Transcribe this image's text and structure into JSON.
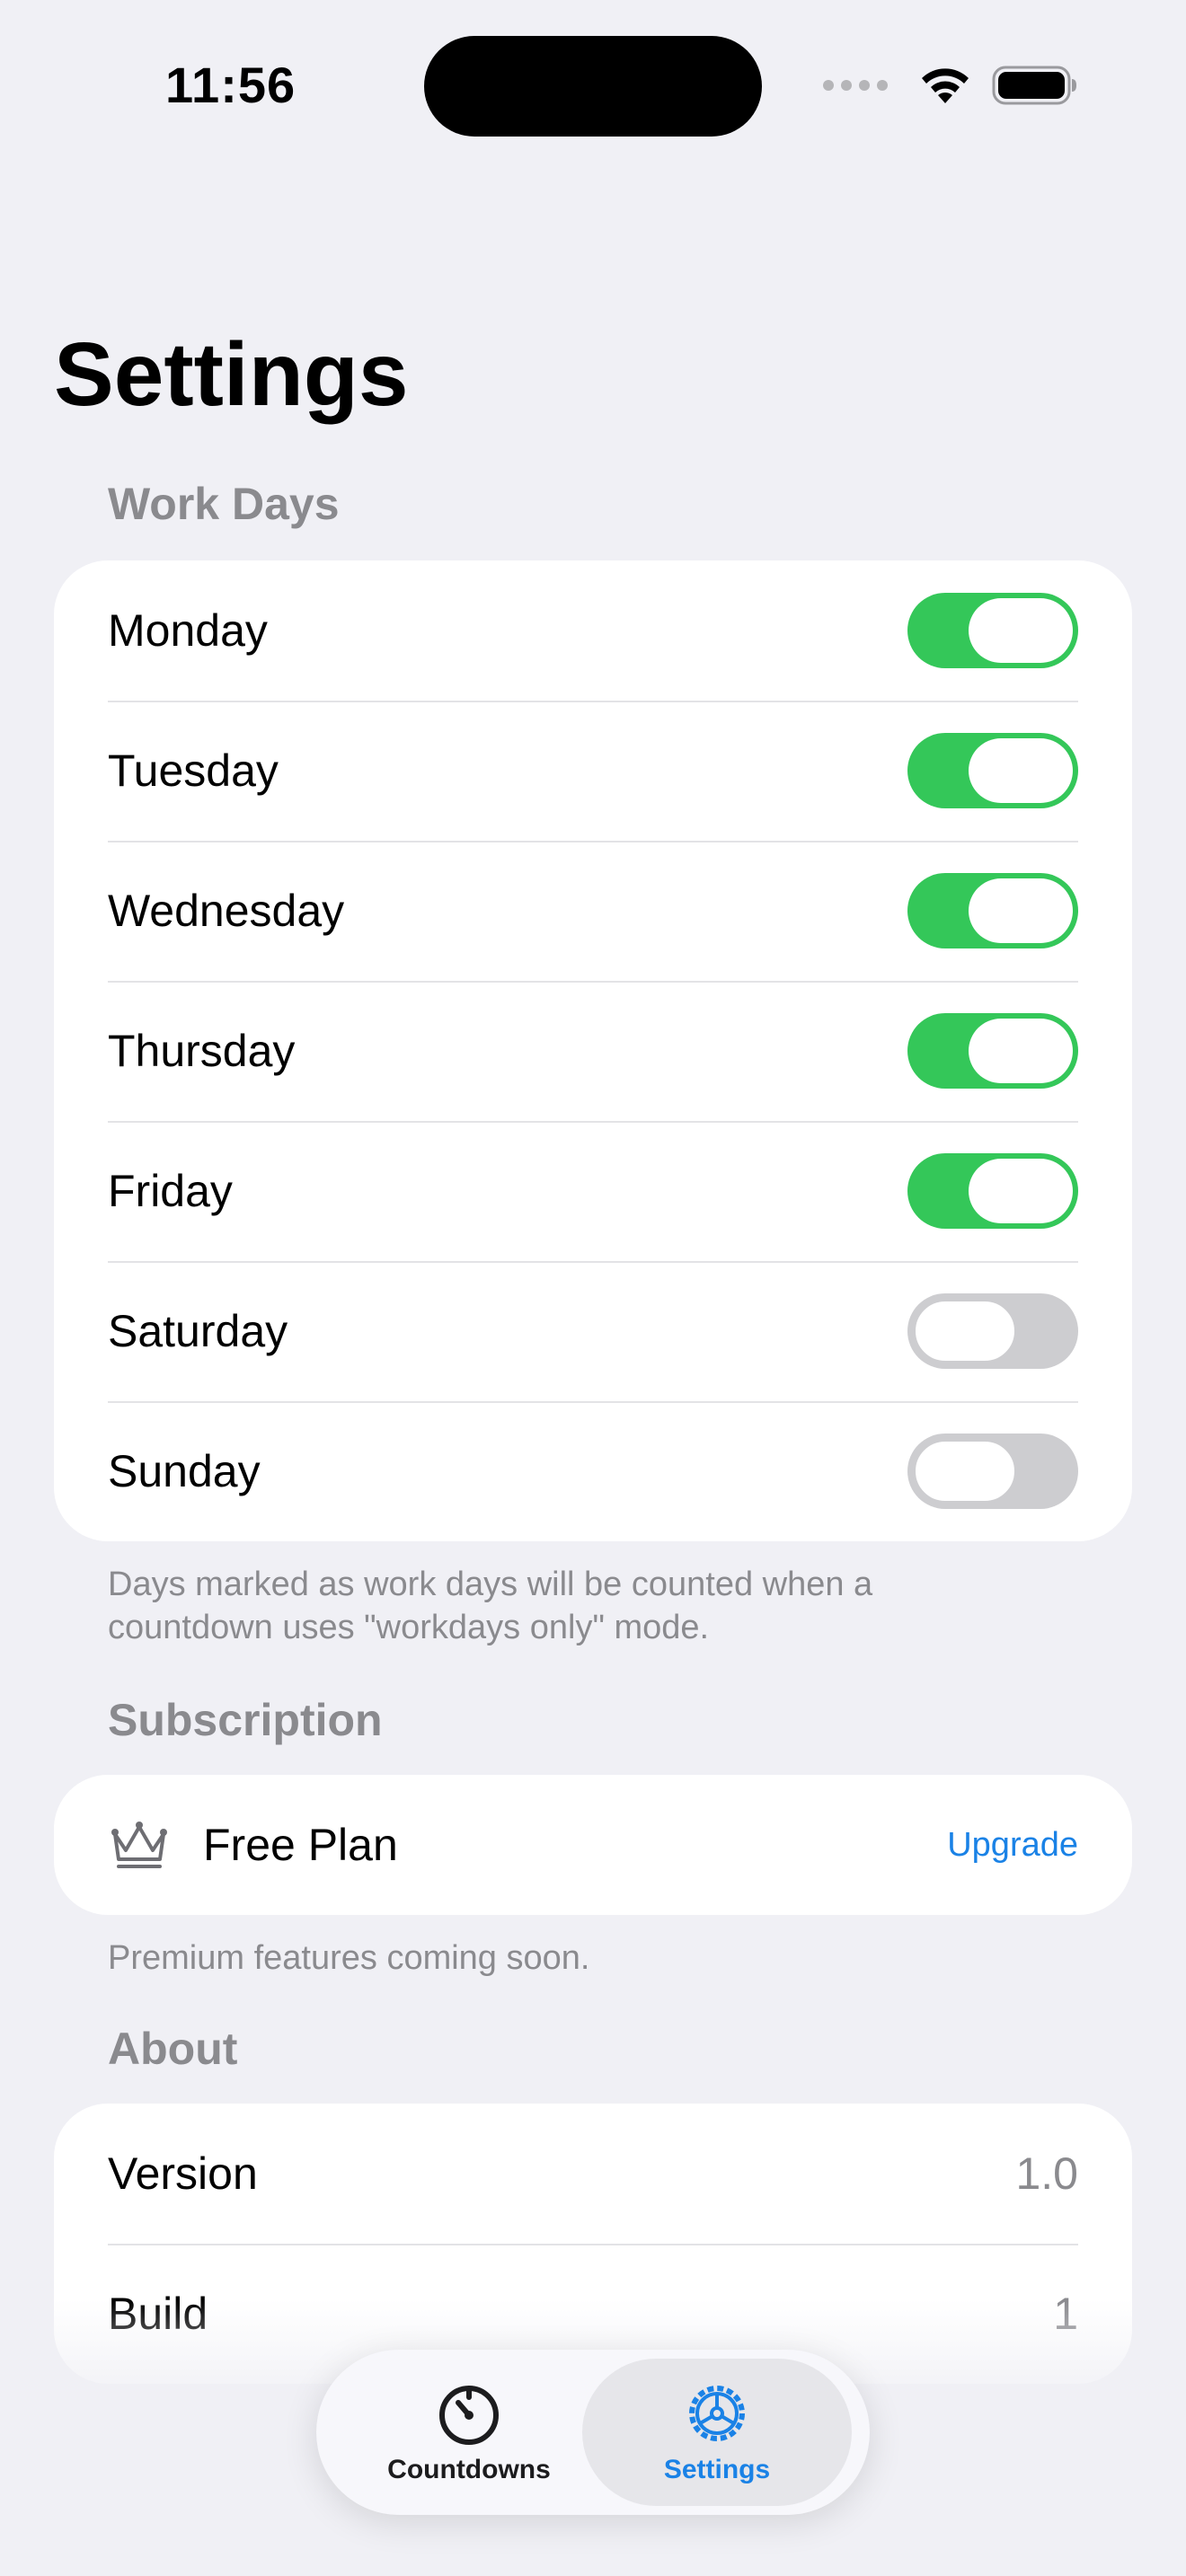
{
  "status_bar": {
    "time": "11:56"
  },
  "page": {
    "title": "Settings"
  },
  "work_days": {
    "header": "Work Days",
    "days": [
      {
        "label": "Monday",
        "on": true
      },
      {
        "label": "Tuesday",
        "on": true
      },
      {
        "label": "Wednesday",
        "on": true
      },
      {
        "label": "Thursday",
        "on": true
      },
      {
        "label": "Friday",
        "on": true
      },
      {
        "label": "Saturday",
        "on": false
      },
      {
        "label": "Sunday",
        "on": false
      }
    ],
    "footnote": "Days marked as work days will be counted when a countdown uses \"workdays only\" mode."
  },
  "subscription": {
    "header": "Subscription",
    "icon": "crown-icon",
    "plan": "Free Plan",
    "upgrade_label": "Upgrade",
    "footnote": "Premium features coming soon."
  },
  "about": {
    "header": "About",
    "rows": [
      {
        "label": "Version",
        "value": "1.0"
      },
      {
        "label": "Build",
        "value": "1"
      }
    ]
  },
  "tab_bar": {
    "tabs": [
      {
        "label": "Countdowns",
        "icon": "timer-icon",
        "selected": false
      },
      {
        "label": "Settings",
        "icon": "gear-icon",
        "selected": true
      }
    ]
  },
  "colors": {
    "accent": "#1a82e6",
    "toggle_on": "#34c759",
    "toggle_off": "#cdcdd0",
    "background": "#f0f0f5"
  }
}
